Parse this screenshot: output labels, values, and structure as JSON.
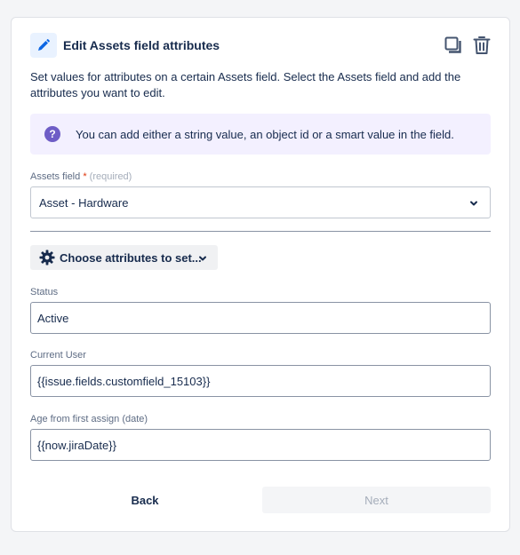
{
  "header": {
    "title": "Edit Assets field attributes",
    "icon": "pencil-icon",
    "actions": [
      "duplicate-icon",
      "trash-icon"
    ]
  },
  "description": "Set values for attributes on a certain Assets field. Select the Assets field and add the attributes you want to edit.",
  "info_banner": {
    "icon": "question-icon",
    "text": "You can add either a string value, an object id or a smart value in the field."
  },
  "assets_field": {
    "label": "Assets field",
    "required_star": "*",
    "required_text": "(required)",
    "value": "Asset - Hardware"
  },
  "choose_attributes": {
    "label": "Choose attributes to set..."
  },
  "attributes": [
    {
      "label": "Status",
      "value": "Active"
    },
    {
      "label": "Current User",
      "value": "{{issue.fields.customfield_15103}}"
    },
    {
      "label": "Age from first assign (date)",
      "value": "{{now.jiraDate}}"
    }
  ],
  "footer": {
    "back_label": "Back",
    "next_label": "Next",
    "next_disabled": true
  },
  "colors": {
    "accent": "#0c66e4",
    "info_bg": "#f3f0ff",
    "info_icon": "#6e5dc6",
    "text": "#172b4d"
  }
}
